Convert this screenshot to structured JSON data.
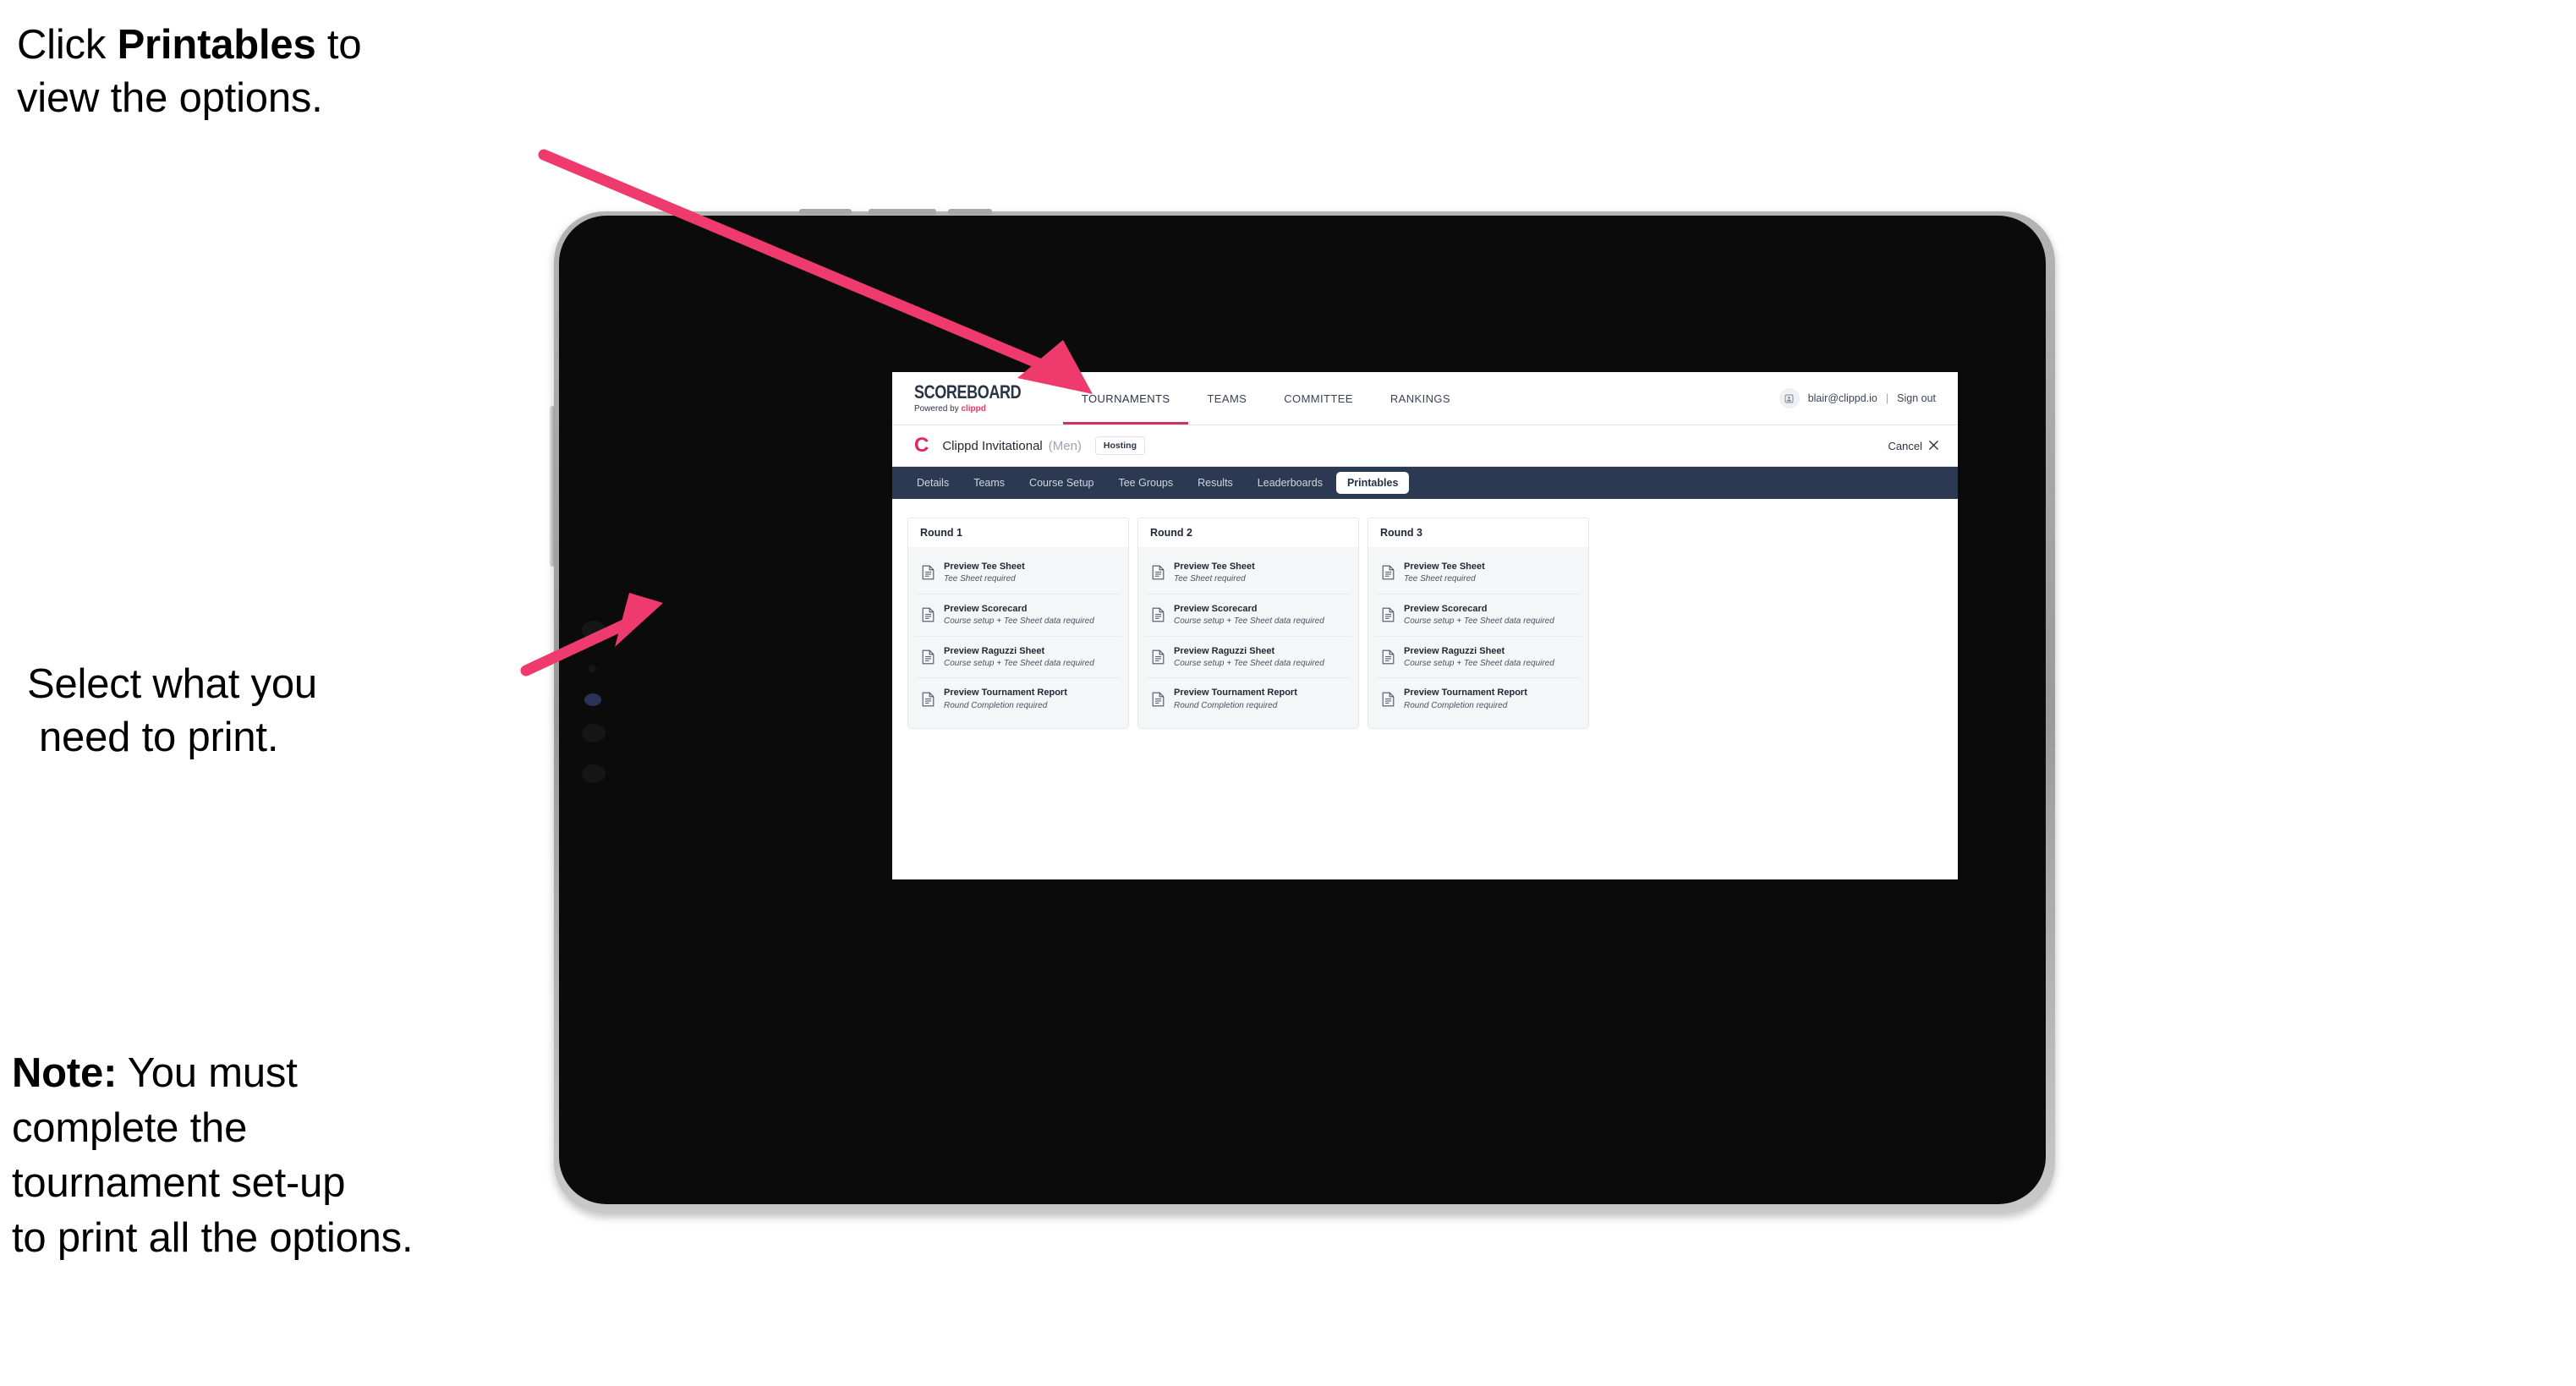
{
  "annotations": {
    "printables_prefix": "Click ",
    "printables_bold": "Printables",
    "printables_suffix": " to\nview the options.",
    "select_line1": "Select what you",
    "select_line2": "need to print.",
    "note_bold": "Note:",
    "note_rest": " You must\ncomplete the\ntournament set-up\nto print all the options.",
    "arrow_color": "#ef3a6e"
  },
  "app": {
    "topnav": {
      "brand_name": "SCOREBOARD",
      "brand_sub_prefix": "Powered by ",
      "brand_sub_accent": "clippd",
      "items": [
        {
          "label": "TOURNAMENTS",
          "active": true
        },
        {
          "label": "TEAMS",
          "active": false
        },
        {
          "label": "COMMITTEE",
          "active": false
        },
        {
          "label": "RANKINGS",
          "active": false
        }
      ],
      "avatar_icon": "user-avatar-icon",
      "user_email": "blair@clippd.io",
      "separator": "|",
      "sign_out": "Sign out"
    },
    "tournament_header": {
      "club_logo": "C",
      "name": "Clippd Invitational",
      "gender": "(Men)",
      "badge": "Hosting",
      "cancel_label": "Cancel",
      "cancel_icon": "close-icon"
    },
    "tabs": [
      {
        "label": "Details",
        "active": false
      },
      {
        "label": "Teams",
        "active": false
      },
      {
        "label": "Course Setup",
        "active": false
      },
      {
        "label": "Tee Groups",
        "active": false
      },
      {
        "label": "Results",
        "active": false
      },
      {
        "label": "Leaderboards",
        "active": false
      },
      {
        "label": "Printables",
        "active": true
      }
    ],
    "rounds": [
      {
        "title": "Round 1",
        "items": [
          {
            "title": "Preview Tee Sheet",
            "sub": "Tee Sheet required"
          },
          {
            "title": "Preview Scorecard",
            "sub": "Course setup + Tee Sheet data required"
          },
          {
            "title": "Preview Raguzzi Sheet",
            "sub": "Course setup + Tee Sheet data required"
          },
          {
            "title": "Preview Tournament Report",
            "sub": "Round Completion required"
          }
        ]
      },
      {
        "title": "Round 2",
        "items": [
          {
            "title": "Preview Tee Sheet",
            "sub": "Tee Sheet required"
          },
          {
            "title": "Preview Scorecard",
            "sub": "Course setup + Tee Sheet data required"
          },
          {
            "title": "Preview Raguzzi Sheet",
            "sub": "Course setup + Tee Sheet data required"
          },
          {
            "title": "Preview Tournament Report",
            "sub": "Round Completion required"
          }
        ]
      },
      {
        "title": "Round 3",
        "items": [
          {
            "title": "Preview Tee Sheet",
            "sub": "Tee Sheet required"
          },
          {
            "title": "Preview Scorecard",
            "sub": "Course setup + Tee Sheet data required"
          },
          {
            "title": "Preview Raguzzi Sheet",
            "sub": "Course setup + Tee Sheet data required"
          },
          {
            "title": "Preview Tournament Report",
            "sub": "Round Completion required"
          }
        ]
      }
    ]
  },
  "colors": {
    "accent_pink": "#e6376f",
    "navbar_dark": "#2b3a52",
    "brand_navy": "#2b3446",
    "arrow": "#ef3a6e"
  }
}
